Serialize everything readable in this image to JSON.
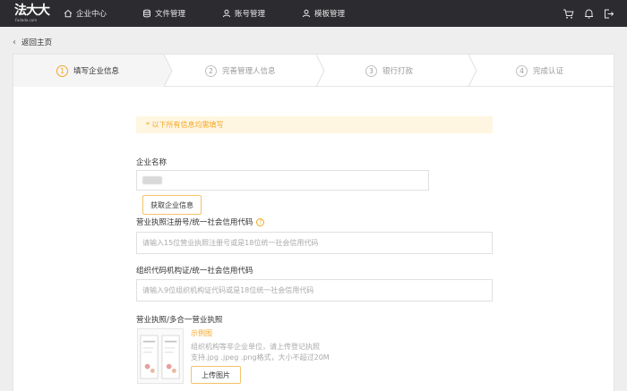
{
  "header": {
    "logo_cn": "法大大",
    "logo_en": "Fadada.com",
    "nav": [
      {
        "label": "企业中心",
        "icon": "home-icon"
      },
      {
        "label": "文件管理",
        "icon": "database-icon"
      },
      {
        "label": "账号管理",
        "icon": "user-icon"
      },
      {
        "label": "模板管理",
        "icon": "user-icon"
      }
    ],
    "right_icons": [
      "cart-icon",
      "bell-icon",
      "logout-icon"
    ]
  },
  "back": {
    "label": "返回主页"
  },
  "steps": [
    {
      "num": "1",
      "label": "填写企业信息",
      "active": true
    },
    {
      "num": "2",
      "label": "完善管理人信息",
      "active": false
    },
    {
      "num": "3",
      "label": "银行打款",
      "active": false
    },
    {
      "num": "4",
      "label": "完成认证",
      "active": false
    }
  ],
  "form": {
    "notice": "* 以下所有信息均需填写",
    "company_name": {
      "label": "企业名称"
    },
    "fetch_button": "获取企业信息",
    "license": {
      "label": "营业执照注册号/统一社会信用代码",
      "help": "?",
      "placeholder": "请输入15位营业执照注册号或是18位统一社会信用代码"
    },
    "org_code": {
      "label": "组织代码机构证/统一社会信用代码",
      "placeholder": "请输入9位组织机构证代码或是18位统一社会信用代码"
    },
    "upload": {
      "label": "营业执照/多合一营业执照",
      "sample_link": "示例图",
      "hint_line1": "组织机构等非企业单位，请上传登记执照",
      "hint_line2": "支持.jpg .jpeg .png格式，大小不超过20M",
      "button": "上传图片"
    }
  },
  "colors": {
    "accent": "#f5a623",
    "topbar": "#2c2c30",
    "notice_bg": "#fff6e1"
  }
}
